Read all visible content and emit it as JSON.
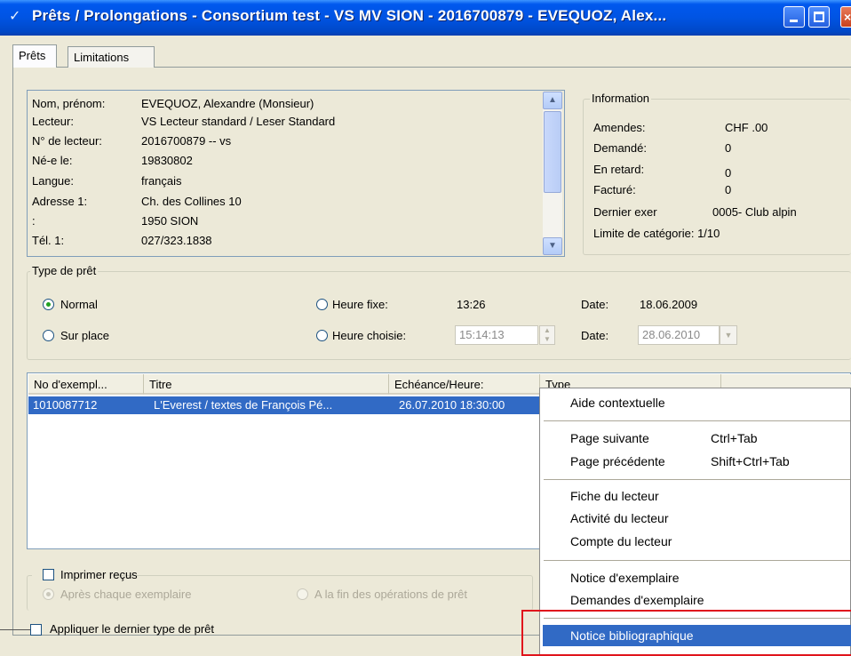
{
  "window": {
    "title": "Prêts / Prolongations - Consortium test - VS MV SION - 2016700879 - EVEQUOZ, Alex..."
  },
  "tabs": [
    {
      "label": "Prêts"
    },
    {
      "label": "Limitations"
    }
  ],
  "reader": {
    "rows": [
      {
        "label": "Nom, prénom:",
        "value": "EVEQUOZ, Alexandre (Monsieur)"
      },
      {
        "label": "Lecteur:",
        "value": "VS Lecteur standard / Leser Standard"
      },
      {
        "label": "N° de lecteur:",
        "value": "2016700879 -- vs"
      },
      {
        "label": "Né-e le:",
        "value": "19830802"
      },
      {
        "label": "Langue:",
        "value": "français"
      },
      {
        "label": "Adresse 1:",
        "value": "Ch. des Collines 10"
      },
      {
        "label": ":",
        "value": "1950 SION"
      },
      {
        "label": "Tél. 1:",
        "value": "027/323.1838"
      }
    ]
  },
  "information": {
    "title": "Information",
    "rows": [
      {
        "label": "Amendes:",
        "value": "CHF .00"
      },
      {
        "label": "Demandé:",
        "value": "0"
      },
      {
        "label": "En retard:",
        "value": "0"
      },
      {
        "label": "Facturé:",
        "value": "0"
      },
      {
        "label": "Dernier exer",
        "value": "0005- Club alpin"
      }
    ],
    "limit": "Limite de catégorie: 1/10"
  },
  "loan_type": {
    "title": "Type de prêt",
    "normal": "Normal",
    "sur_place": "Sur place",
    "heure_fixe": "Heure fixe:",
    "heure_fixe_value": "13:26",
    "heure_choisie": "Heure choisie:",
    "heure_choisie_value": "15:14:13",
    "date_label": "Date:",
    "date1": "18.06.2009",
    "date2": "28.06.2010"
  },
  "list": {
    "columns": [
      "No d'exempl...",
      "Titre",
      "Echéance/Heure:",
      "Type"
    ],
    "rows": [
      {
        "no": "1010087712",
        "titre": "L'Everest / textes de François Pé...",
        "echeance": "26.07.2010 18:30:00"
      }
    ]
  },
  "print": {
    "title": "Imprimer reçus",
    "after_each": "Après chaque exemplaire",
    "at_end": "A la fin des opérations de prêt"
  },
  "apply_last": "Appliquer le dernier type de prêt",
  "context_menu": {
    "items": [
      {
        "label": "Aide contextuelle",
        "shortcut": ""
      },
      {
        "label": "Page suivante",
        "shortcut": "Ctrl+Tab"
      },
      {
        "label": "Page précédente",
        "shortcut": "Shift+Ctrl+Tab"
      },
      {
        "label": "Fiche du lecteur",
        "shortcut": ""
      },
      {
        "label": "Activité du lecteur",
        "shortcut": ""
      },
      {
        "label": "Compte du lecteur",
        "shortcut": ""
      },
      {
        "label": "Notice d'exemplaire",
        "shortcut": ""
      },
      {
        "label": "Demandes d'exemplaire",
        "shortcut": ""
      },
      {
        "label": "Notice bibliographique",
        "shortcut": ""
      }
    ]
  },
  "colors": {
    "titlebar": "#0054e3",
    "selection": "#316ac5",
    "highlight_box": "#e0141c",
    "window_bg": "#ece9d8"
  }
}
